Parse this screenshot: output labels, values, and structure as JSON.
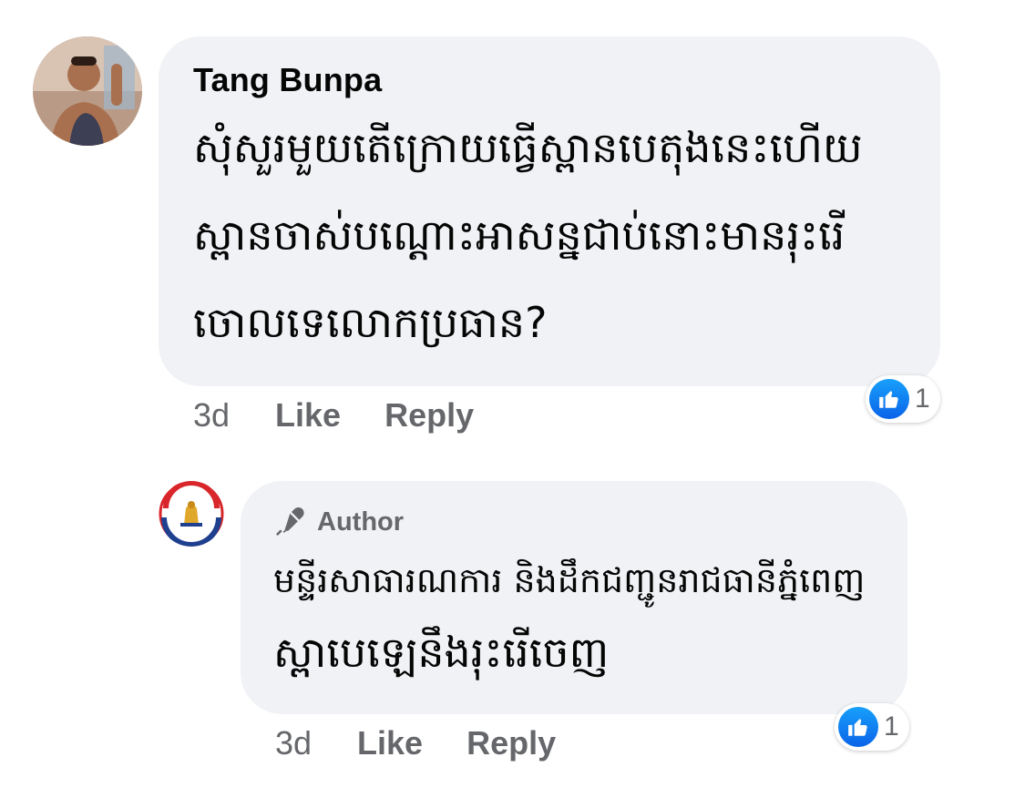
{
  "comment": {
    "author": "Tang Bunpa",
    "text_lines": [
      "សុំសួរមួយតើក្រោយធ្វើស្ពានបេតុងនេះហើយ",
      "ស្ពានចាស់បណ្ដោះអាសន្នជាប់នោះមានរុះរើ",
      "ចោលទេលោកប្រធាន?"
    ],
    "timestamp": "3d",
    "like_label": "Like",
    "reply_label": "Reply",
    "reaction_count": "1",
    "reaction_icon": "like-thumbs-up-icon",
    "avatar_icon": "user-photo-avatar"
  },
  "reply": {
    "badge_icon": "microphone-icon",
    "badge_label": "Author",
    "text_lines": [
      "មន្ទីរសាធារណការ និងដឹកជញ្ជូនរាជធានីភ្នំពេញ",
      "ស្ពាបេឡេនឹងរុះរើចេញ"
    ],
    "timestamp": "3d",
    "like_label": "Like",
    "reply_label": "Reply",
    "reaction_count": "1",
    "reaction_icon": "like-thumbs-up-icon",
    "avatar_icon": "ministry-logo-avatar"
  },
  "colors": {
    "bubble": "#f0f2f5",
    "secondary_text": "#65676b",
    "like_blue": "#0a63e8"
  }
}
